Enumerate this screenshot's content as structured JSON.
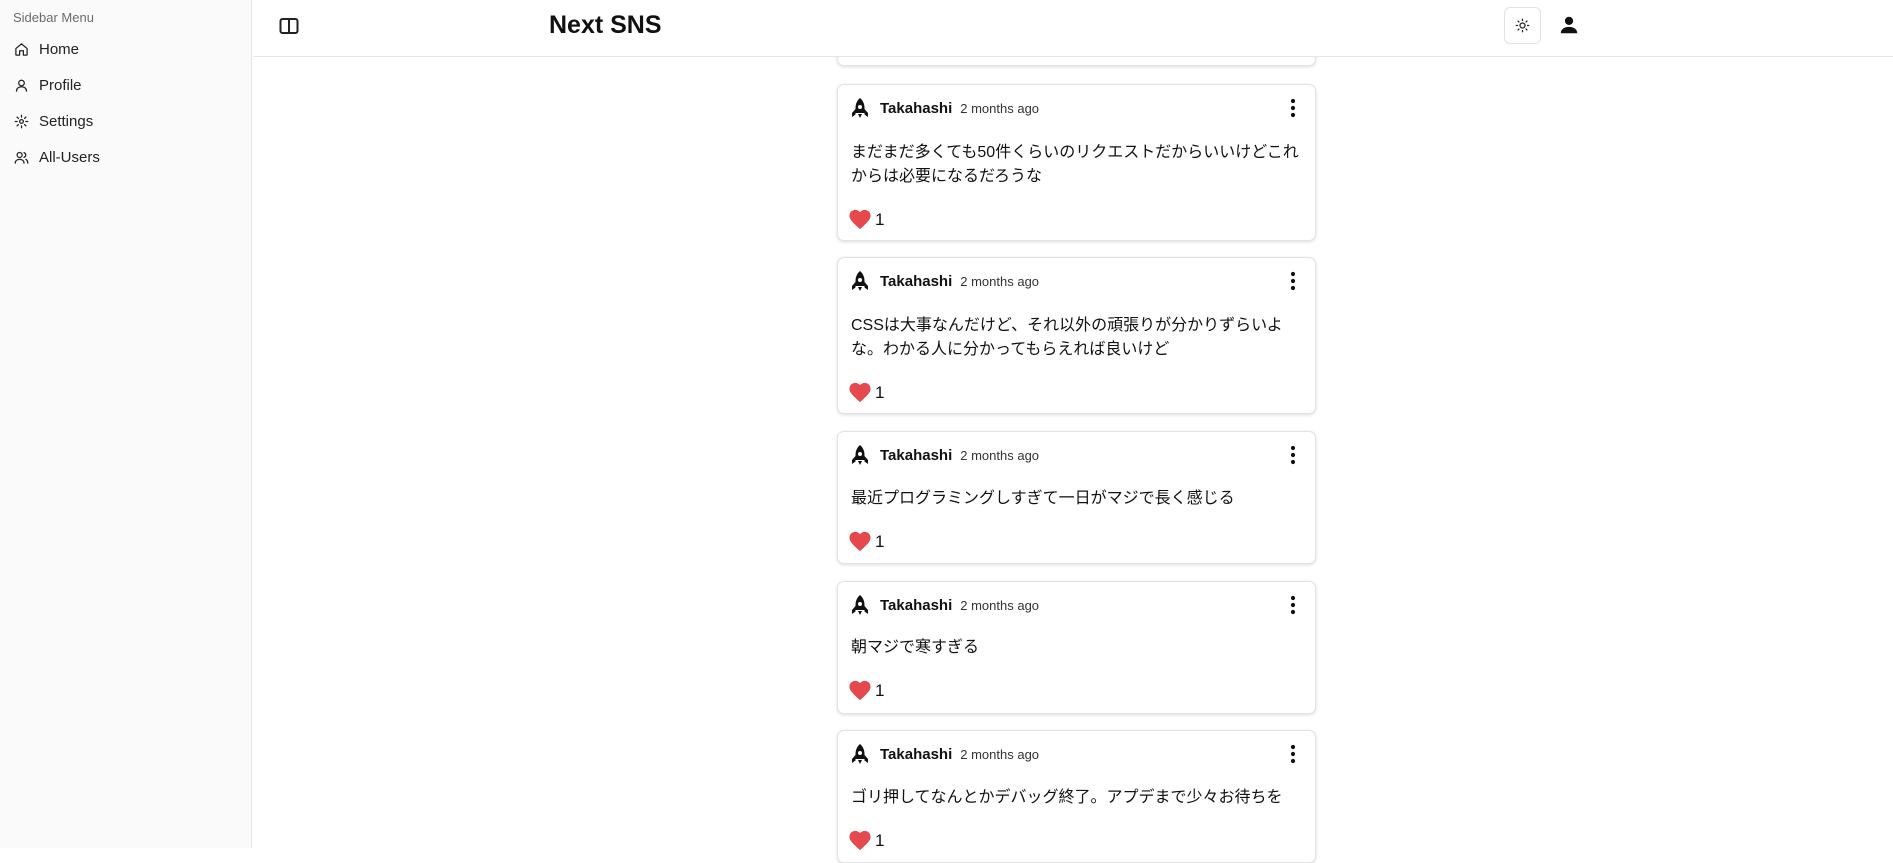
{
  "sidebar": {
    "title": "Sidebar Menu",
    "items": [
      {
        "label": "Home",
        "icon": "home-icon"
      },
      {
        "label": "Profile",
        "icon": "user-icon"
      },
      {
        "label": "Settings",
        "icon": "gear-icon"
      },
      {
        "label": "All-Users",
        "icon": "users-icon"
      }
    ]
  },
  "header": {
    "title": "Next SNS",
    "toggle_icon": "sidebar-toggle-icon",
    "theme_icon": "sun-icon",
    "account_icon": "person-icon"
  },
  "colors": {
    "heart": "#e5484d",
    "border": "#e3e3e3",
    "sidebar_bg": "#fafafa"
  },
  "posts": [
    {
      "author": "",
      "time": "",
      "content": "…",
      "likes": ""
    },
    {
      "author": "Takahashi",
      "time": "2 months ago",
      "content": "まだまだ多くても50件くらいのリクエストだからいいけどこれからは必要になるだろうな",
      "likes": "1"
    },
    {
      "author": "Takahashi",
      "time": "2 months ago",
      "content": "CSSは大事なんだけど、それ以外の頑張りが分かりずらいよな。わかる人に分かってもらえれば良いけど",
      "likes": "1"
    },
    {
      "author": "Takahashi",
      "time": "2 months ago",
      "content": "最近プログラミングしすぎて一日がマジで長く感じる",
      "likes": "1"
    },
    {
      "author": "Takahashi",
      "time": "2 months ago",
      "content": "朝マジで寒すぎる",
      "likes": "1"
    },
    {
      "author": "Takahashi",
      "time": "2 months ago",
      "content": "ゴリ押してなんとかデバッグ終了。アプデまで少々お待ちを",
      "likes": "1"
    }
  ]
}
